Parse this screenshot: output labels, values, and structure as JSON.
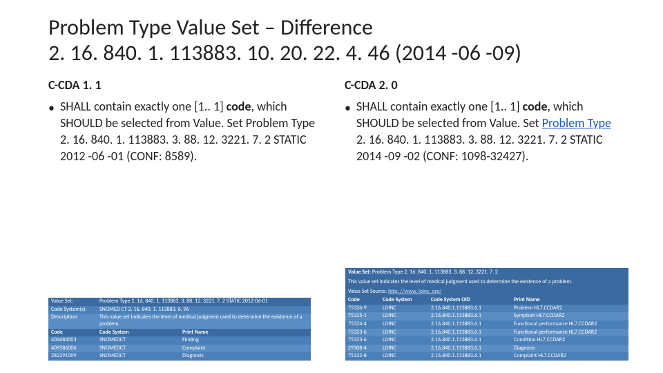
{
  "title_line1": "Problem Type Value Set – Difference",
  "title_line2": "2. 16. 840. 1. 113883. 10. 20. 22. 4. 46 (2014 -06 -09)",
  "left": {
    "heading": "C-CDA 1. 1",
    "bullet_pre": "SHALL contain exactly one [1.. 1] ",
    "bullet_code": "code",
    "bullet_post1": ", which SHOULD be selected from Value. Set Problem Type 2. 16. 840. 1. 113883. 3. 88. 12. 3221. 7. 2 STATIC 2012 -06 -01 (CONF: 8589).",
    "vs_label": "Value Set:",
    "vs_value": "Problem Type 2. 16. 840. 1. 113883. 3. 88. 12. 3221. 7. 2 STATIC 2012-06-01",
    "cs_label": "Code System(s):",
    "cs_value": "SNOMED CT 2. 16. 840. 1. 113883. 6. 96",
    "desc_label": "Description:",
    "desc_value": "This value set indicates the level of medical judgment used to determine the existence of a problem.",
    "cols": {
      "c1": "Code",
      "c2": "Code System",
      "c3": "Print Name"
    },
    "rows": [
      {
        "code": "404684003",
        "system": "SNOMEDCT",
        "name": "Finding"
      },
      {
        "code": "409586006",
        "system": "SNOMEDCT",
        "name": "Complaint"
      },
      {
        "code": "282291009",
        "system": "SNOMEDCT",
        "name": "Diagnosis"
      }
    ]
  },
  "right": {
    "heading": "C-CDA 2. 0",
    "bullet_pre": "SHALL contain exactly one [1.. 1] ",
    "bullet_code": "code",
    "bullet_mid": ", which SHOULD be selected from Value. Set ",
    "bullet_link": "Problem Type",
    "bullet_post": " 2. 16. 840. 1. 113883. 3. 88. 12. 3221. 7. 2 STATIC 2014 -09 -02 (CONF: 1098-32427).",
    "vs_label": "Value Set:",
    "vs_value": "Problem Type 2. 16. 840. 1. 113883. 3. 88. 12. 3221. 7. 2",
    "note": "This value set indicates the level of medical judgment used to determine the existence of a problem.",
    "src_label": "Value Set Source:",
    "src_link": "http: //www. loinc. org/",
    "cols": {
      "c1": "Code",
      "c2": "Code System",
      "c3": "Code System OID",
      "c4": "Print Name"
    },
    "rows": [
      {
        "code": "75326-9",
        "system": "LOINC",
        "oid": "2.16.840.1.113883.6.1",
        "name": "Problem HL7.CCDAR2"
      },
      {
        "code": "75325-1",
        "system": "LOINC",
        "oid": "2.16.840.1.113883.6.1",
        "name": "Symptom HL7.CCDAR2"
      },
      {
        "code": "75324-4",
        "system": "LOINC",
        "oid": "2.16.840.1.113883.6.1",
        "name": "Functional performance HL7.CCDAR2"
      },
      {
        "code": "75323-6",
        "system": "LOINC",
        "oid": "2.16.840.1.113883.6.1",
        "name": "Functional performance HL7.CCDAR2"
      },
      {
        "code": "75323-6",
        "system": "LOINC",
        "oid": "2.16.840.1.113883.6.1",
        "name": "Condition HL7.CCDAR2"
      },
      {
        "code": "29308-4",
        "system": "LOINC",
        "oid": "2.16.840.1.113883.6.1",
        "name": "Diagnosis"
      },
      {
        "code": "75322-8",
        "system": "LOINC",
        "oid": "2.16.840.1.113883.6.1",
        "name": "Complaint HL7.CCDAR2"
      }
    ]
  }
}
